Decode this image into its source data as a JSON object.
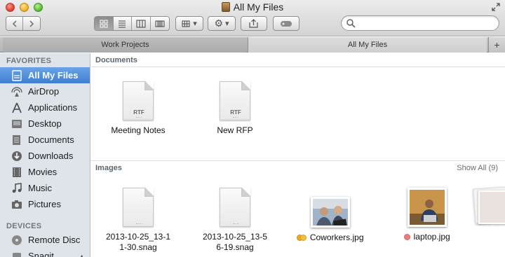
{
  "window": {
    "title": "All My Files"
  },
  "toolbar": {
    "back_label": "◀",
    "forward_label": "▶",
    "view_modes": [
      "icon",
      "list",
      "column",
      "coverflow"
    ],
    "active_view": "icon",
    "arrange_label": "▾",
    "action_label": "▾",
    "share_label": "",
    "tags_label": ""
  },
  "search": {
    "placeholder": "",
    "value": ""
  },
  "tabs": [
    {
      "label": "Work Projects",
      "active": false
    },
    {
      "label": "All My Files",
      "active": true
    }
  ],
  "tab_add_label": "+",
  "sidebar": {
    "favorites_heading": "FAVORITES",
    "devices_heading": "DEVICES",
    "items": [
      {
        "label": "All My Files",
        "icon": "all-my-files-icon",
        "selected": true
      },
      {
        "label": "AirDrop",
        "icon": "airdrop-icon"
      },
      {
        "label": "Applications",
        "icon": "applications-icon"
      },
      {
        "label": "Desktop",
        "icon": "desktop-icon"
      },
      {
        "label": "Documents",
        "icon": "documents-icon"
      },
      {
        "label": "Downloads",
        "icon": "downloads-icon"
      },
      {
        "label": "Movies",
        "icon": "movies-icon"
      },
      {
        "label": "Music",
        "icon": "music-icon"
      },
      {
        "label": "Pictures",
        "icon": "pictures-icon"
      }
    ],
    "devices": [
      {
        "label": "Remote Disc",
        "icon": "remote-disc-icon"
      },
      {
        "label": "Snagit",
        "icon": "disk-image-icon",
        "eject": true
      }
    ]
  },
  "documents": {
    "heading": "Documents",
    "files": [
      {
        "name": "Meeting Notes",
        "ext": "RTF"
      },
      {
        "name": "New RFP",
        "ext": "RTF"
      }
    ]
  },
  "images": {
    "heading": "Images",
    "show_all": "Show All (9)",
    "files": [
      {
        "name_line1": "2013-10-25_13-1",
        "name_line2": "1-30.snag",
        "type": "generic"
      },
      {
        "name_line1": "2013-10-25_13-5",
        "name_line2": "6-19.snag",
        "type": "generic"
      },
      {
        "name_line1": "Coworkers.jpg",
        "type": "photo",
        "tags": [
          "#f5a623",
          "#f0c040"
        ]
      },
      {
        "name_line1": "laptop.jpg",
        "type": "photo",
        "tags": [
          "#f27a7a"
        ]
      }
    ]
  },
  "colors": {
    "selection": "#3f7fd1",
    "sidebar_bg": "#dfe4ea",
    "heading_text": "#5d6670"
  }
}
